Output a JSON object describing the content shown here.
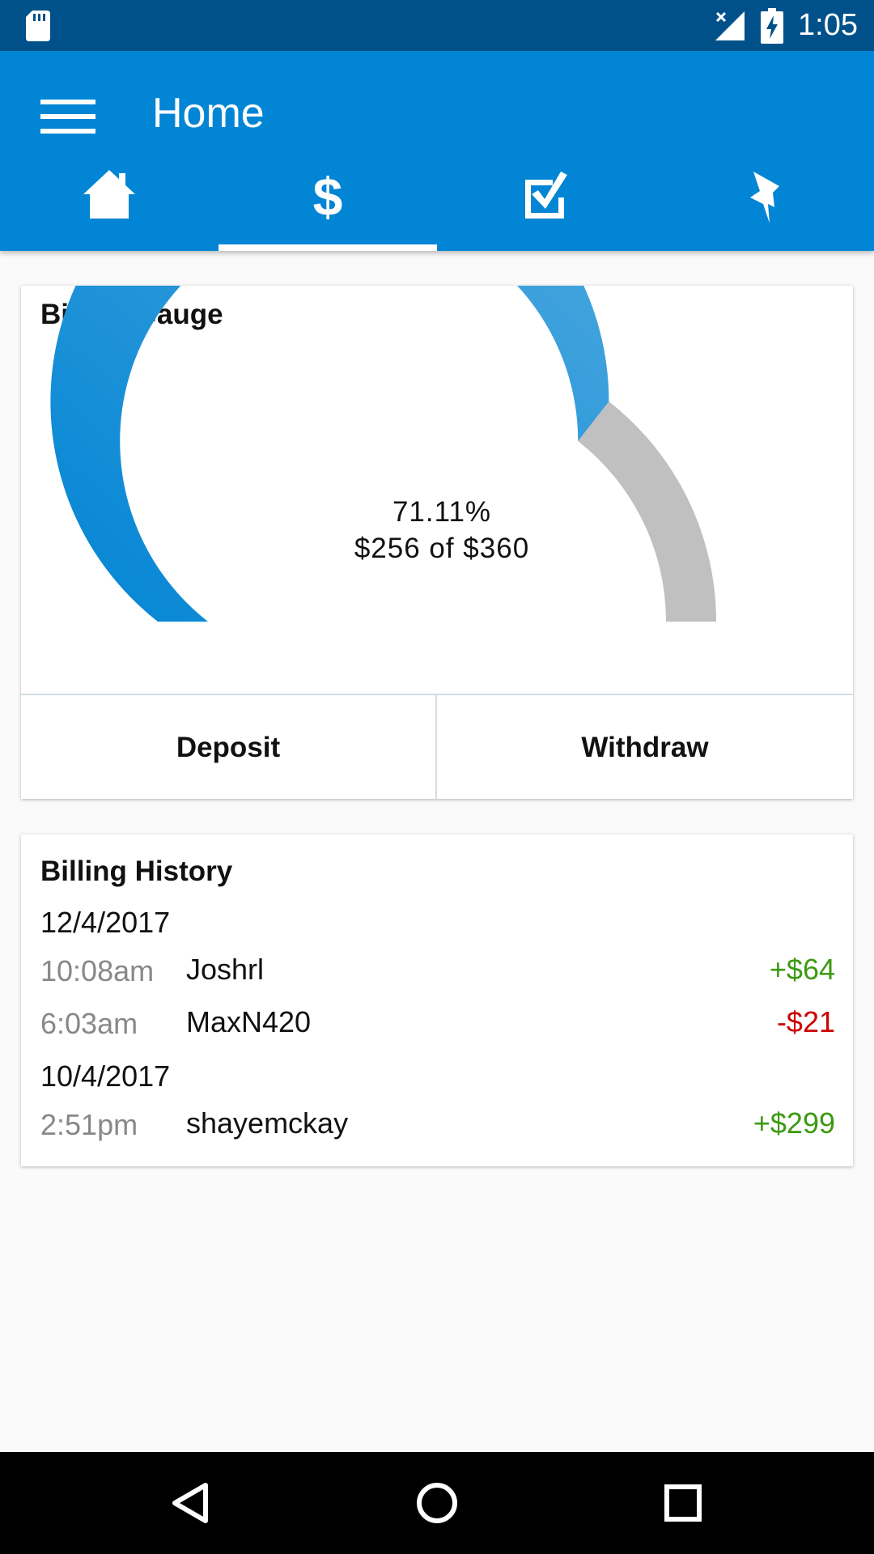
{
  "status_bar": {
    "time": "1:05",
    "icons": [
      "sd-card-icon",
      "signal-off-icon",
      "battery-charging-icon"
    ]
  },
  "app_bar": {
    "title": "Home",
    "menu_icon": "hamburger-menu-icon",
    "tabs": [
      {
        "icon": "home-icon",
        "selected": false
      },
      {
        "icon": "dollar-icon",
        "selected": true
      },
      {
        "icon": "checkbox-icon",
        "selected": false
      },
      {
        "icon": "pin-icon",
        "selected": false
      }
    ]
  },
  "gauge_card": {
    "title": "Billing Gauge",
    "percent_text": "71.11%",
    "amount_text": "$256 of $360",
    "fill_fraction": 0.7111,
    "deposit_label": "Deposit",
    "withdraw_label": "Withdraw"
  },
  "history_card": {
    "title": "Billing History",
    "groups": [
      {
        "date": "12/4/2017",
        "entries": [
          {
            "time": "10:08am",
            "name": "Joshrl",
            "amount": "+$64",
            "type": "credit"
          },
          {
            "time": "6:03am",
            "name": "MaxN420",
            "amount": "-$21",
            "type": "debit"
          }
        ]
      },
      {
        "date": "10/4/2017",
        "entries": [
          {
            "time": "2:51pm",
            "name": "shayemckay",
            "amount": "+$299",
            "type": "credit"
          }
        ]
      }
    ]
  },
  "nav_bar": {
    "buttons": [
      "back-icon",
      "home-circle-icon",
      "recents-square-icon"
    ]
  },
  "colors": {
    "status_bar": "#00518a",
    "app_bar": "#0285d4",
    "gauge_fill_start": "#0285d4",
    "gauge_fill_end": "#4fa9df",
    "gauge_track": "#c0c0c0",
    "credit": "#3c9a10",
    "debit": "#cc0000",
    "muted_text": "#888888"
  }
}
